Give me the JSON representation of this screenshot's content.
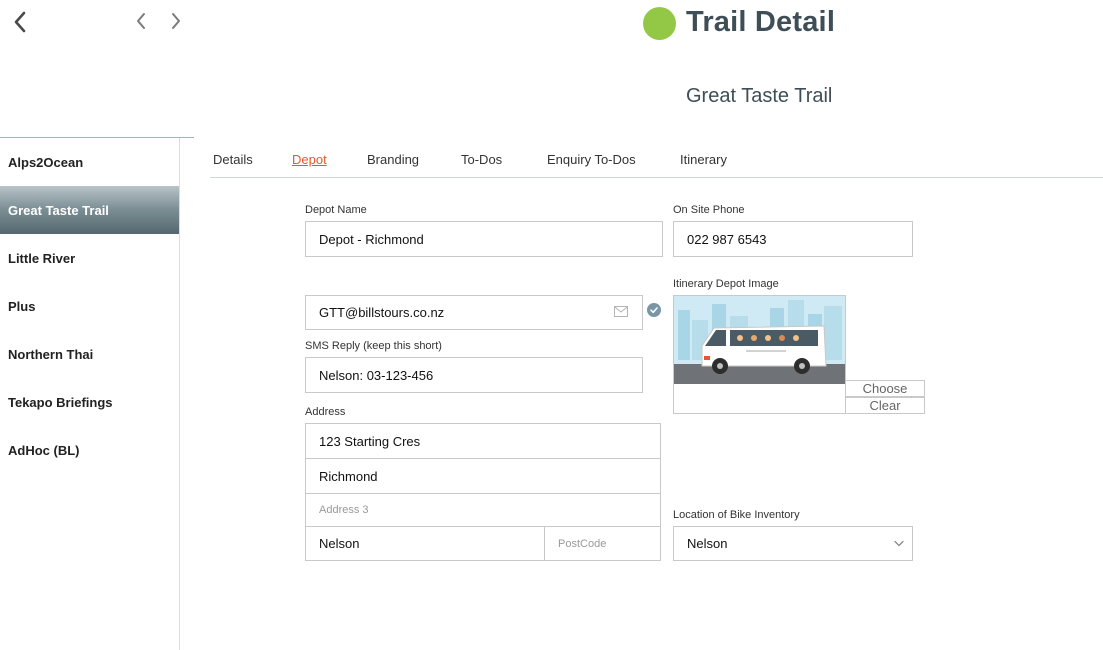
{
  "header": {
    "title": "Trail Detail",
    "subtitle": "Great Taste Trail",
    "status_color": "#93c847",
    "back_icon": "chevron-left-icon",
    "prev_icon": "chevron-left-icon",
    "next_icon": "chevron-right-icon"
  },
  "sidebar": {
    "items": [
      {
        "label": "Alps2Ocean"
      },
      {
        "label": "Great Taste Trail"
      },
      {
        "label": "Little River"
      },
      {
        "label": "Plus"
      },
      {
        "label": "Northern Thai"
      },
      {
        "label": "Tekapo Briefings"
      },
      {
        "label": "AdHoc (BL)"
      }
    ],
    "active_index": 1
  },
  "tabs": [
    {
      "label": "Details"
    },
    {
      "label": "Depot"
    },
    {
      "label": "Branding"
    },
    {
      "label": "To-Dos"
    },
    {
      "label": "Enquiry To-Dos"
    },
    {
      "label": "Itinerary"
    }
  ],
  "active_tab": "Depot",
  "accent_color": "#e8572a",
  "form": {
    "depot_name": {
      "label": "Depot Name",
      "value": "Depot - Richmond"
    },
    "on_site_phone": {
      "label": "On Site Phone",
      "value": "022 987 6543"
    },
    "email": {
      "value": "GTT@billstours.co.nz",
      "icon": "mail-icon",
      "verified_icon": "check-circle-icon"
    },
    "sms_reply": {
      "label": "SMS Reply (keep this short)",
      "value": "Nelson: 03-123-456"
    },
    "itinerary_image": {
      "label": "Itinerary Depot Image",
      "choose_label": "Choose",
      "clear_label": "Clear"
    },
    "address": {
      "label": "Address",
      "line1": "123 Starting Cres",
      "line2": "Richmond",
      "line3_placeholder": "Address 3",
      "city": "Nelson",
      "postcode_placeholder": "PostCode"
    },
    "bike_inventory": {
      "label": "Location of Bike Inventory",
      "value": "Nelson"
    }
  }
}
